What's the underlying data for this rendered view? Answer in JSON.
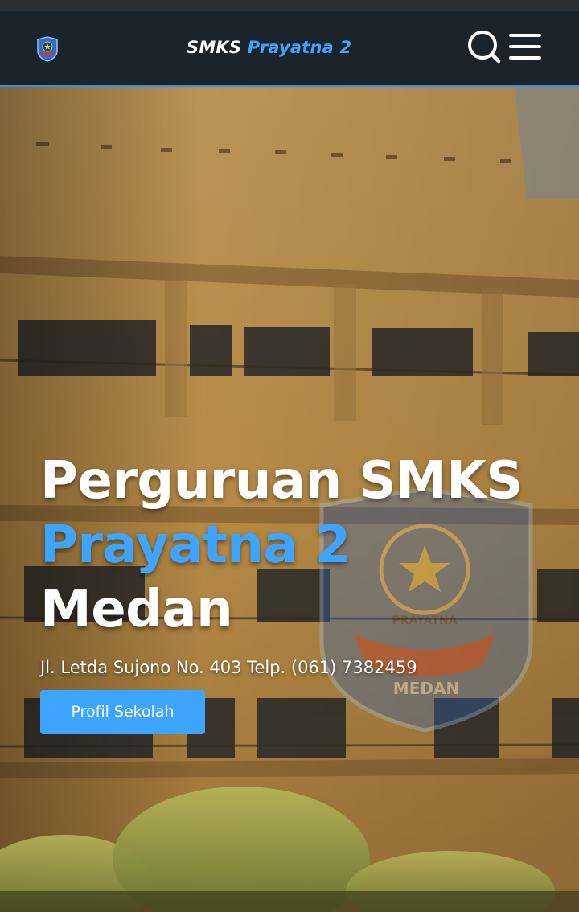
{
  "header": {
    "brand_main": "SMKS",
    "brand_accent": "Prayatna 2",
    "logo_icon": "school-crest-icon",
    "search_icon": "search-icon",
    "menu_icon": "hamburger-menu-icon"
  },
  "hero": {
    "title_line1": "Perguruan SMKS",
    "title_line2": "Prayatna 2",
    "title_line3": "Medan",
    "address": "Jl. Letda Sujono No. 403 Telp. (061) 7382459",
    "button_label": "Profil Sekolah",
    "watermark_text_top": "PRAYATNA",
    "watermark_text_bottom": "MEDAN"
  },
  "colors": {
    "accent": "#3ea5ff",
    "navbar": "#1b232b",
    "white": "#ffffff"
  }
}
